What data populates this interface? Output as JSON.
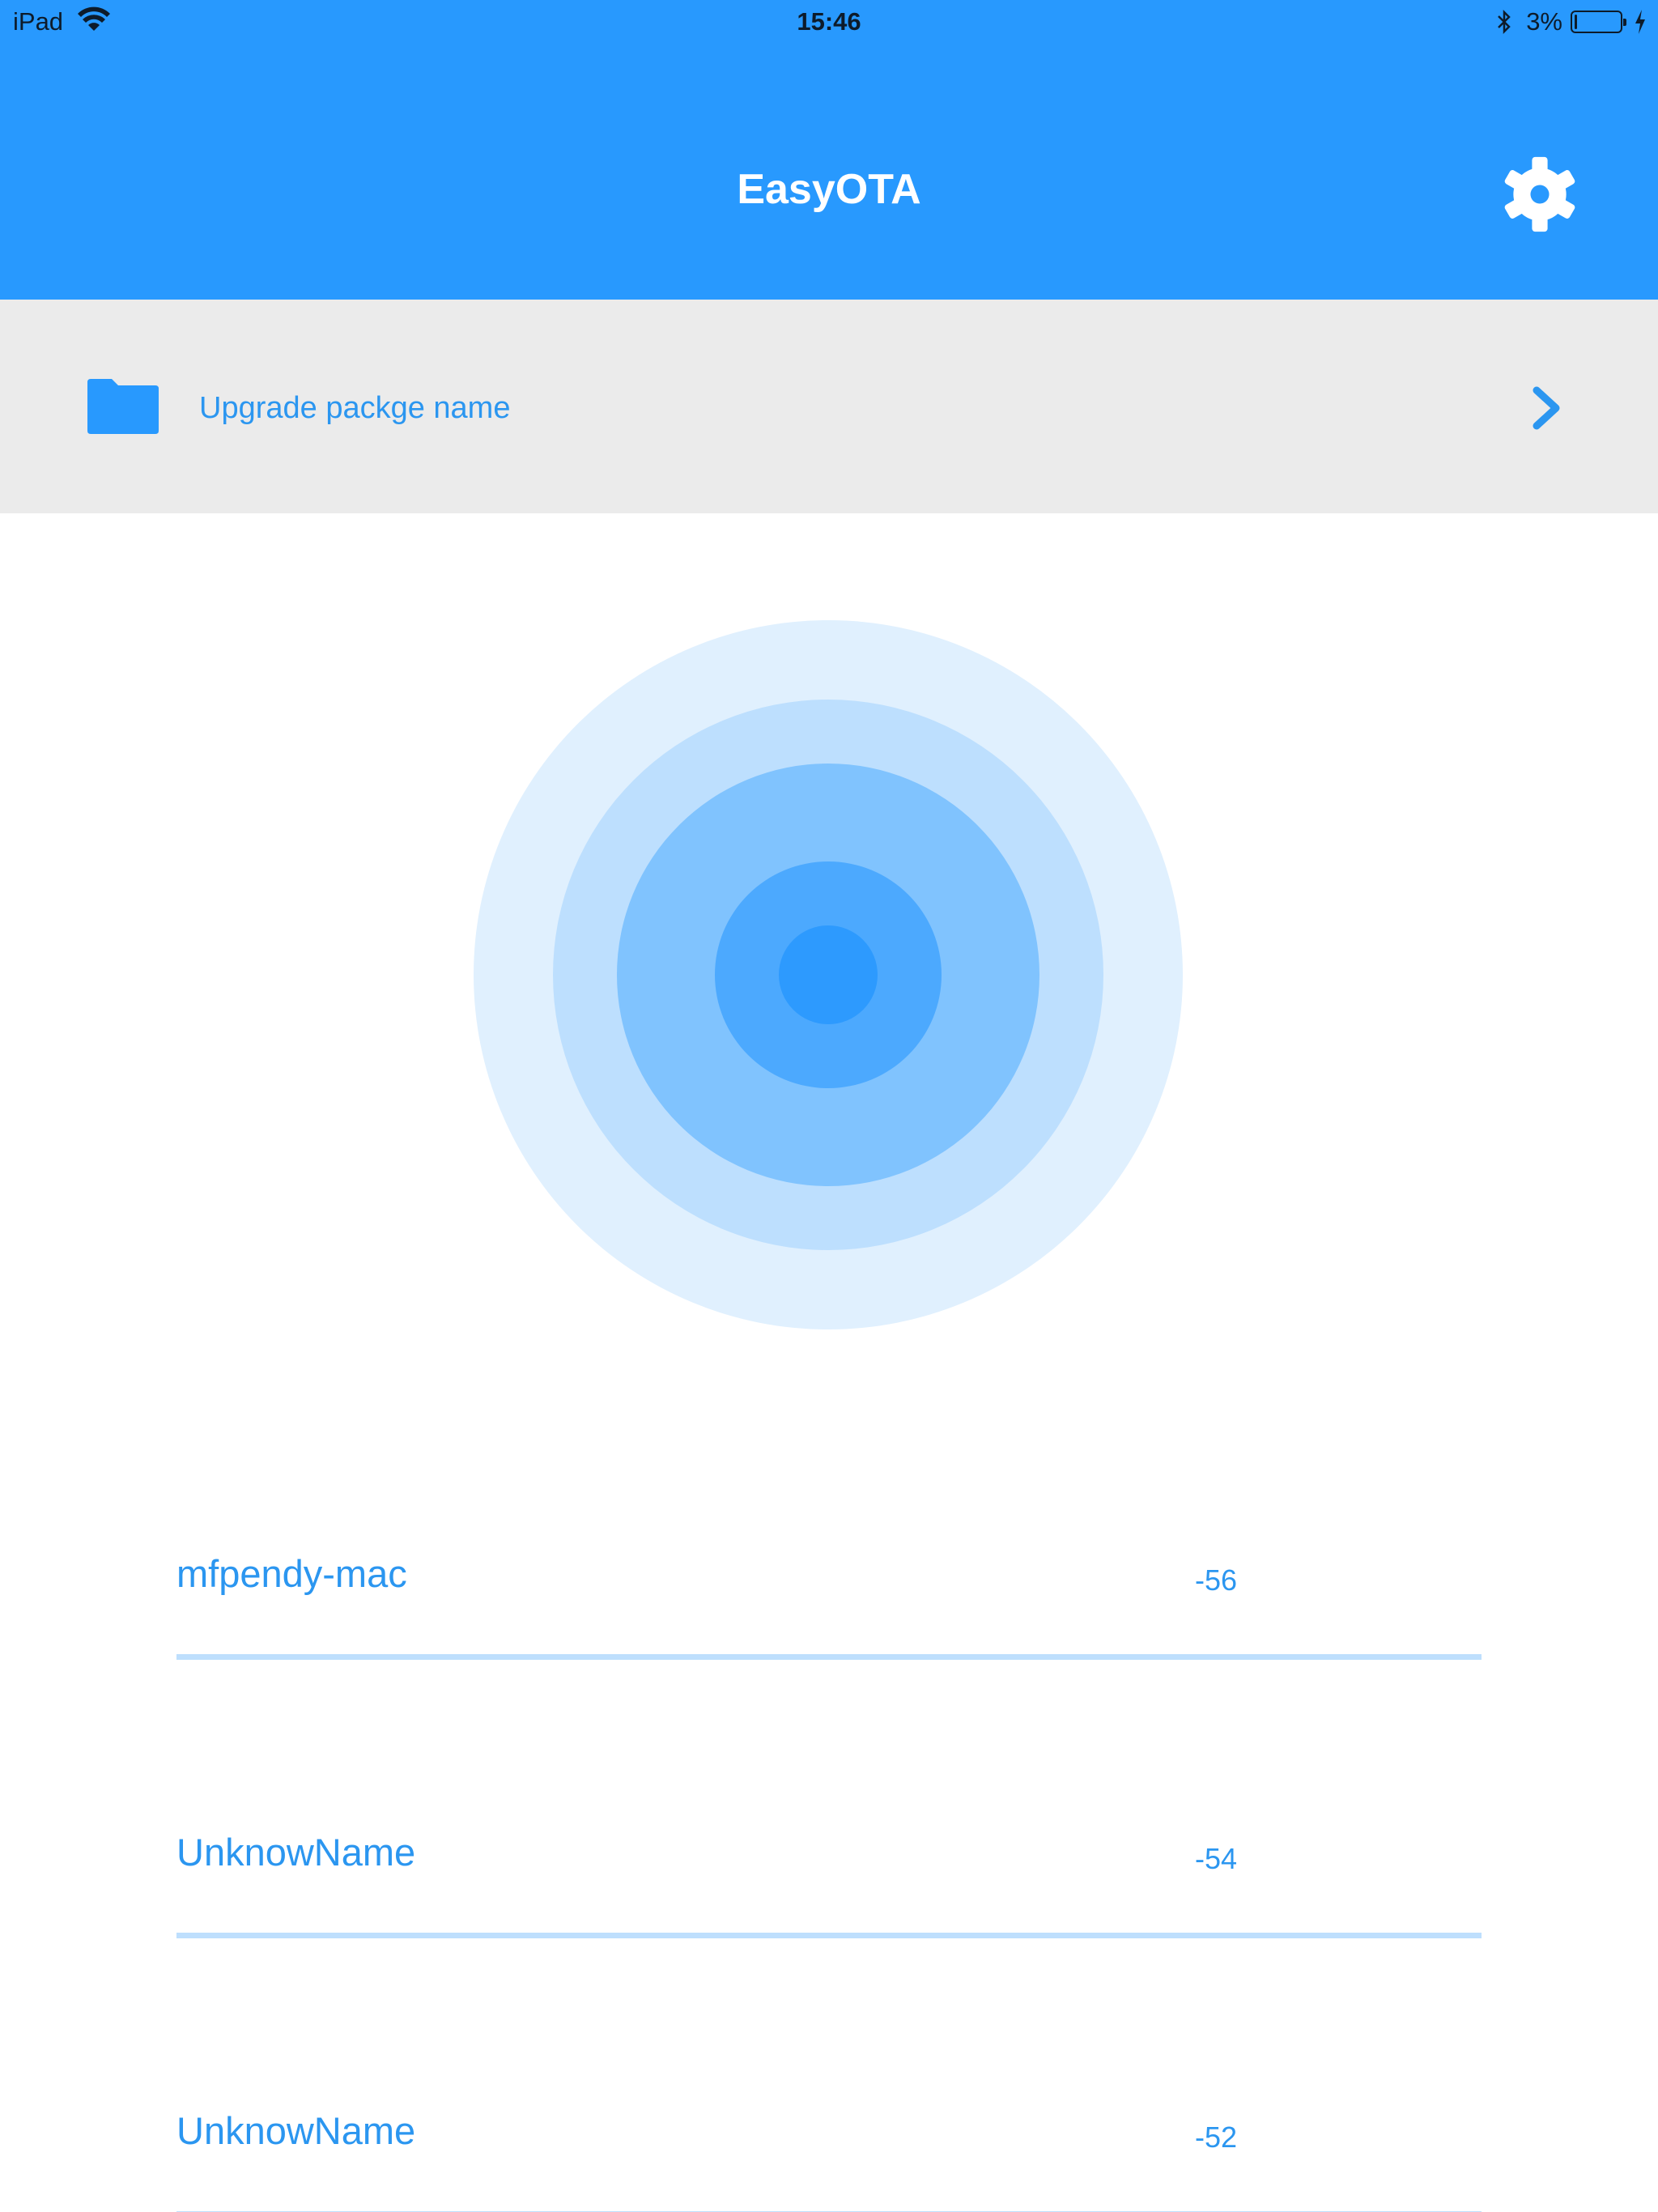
{
  "status_bar": {
    "device": "iPad",
    "time": "15:46",
    "battery_percent": "3%",
    "battery_level": 0.03,
    "icons": [
      "wifi-icon",
      "bluetooth-icon",
      "battery-icon",
      "charging-icon"
    ]
  },
  "navbar": {
    "title": "EasyOTA",
    "settings_icon": "gear-icon"
  },
  "package": {
    "icon": "folder-icon",
    "label": "Upgrade packge name",
    "chevron": "chevron-right-icon"
  },
  "devices": [
    {
      "name": "mfpendy-mac",
      "rssi": "-56"
    },
    {
      "name": "UnknowName",
      "rssi": "-54"
    },
    {
      "name": "UnknowName",
      "rssi": "-52"
    }
  ],
  "colors": {
    "primary": "#2899fe",
    "text_accent": "#2b96f0",
    "row_background": "#ebebeb",
    "divider": "#bedffd",
    "radar_rings": [
      "#e0f0fe",
      "#bddffe",
      "#80c3fe",
      "#4ca9fe",
      "#2d9afe"
    ]
  }
}
